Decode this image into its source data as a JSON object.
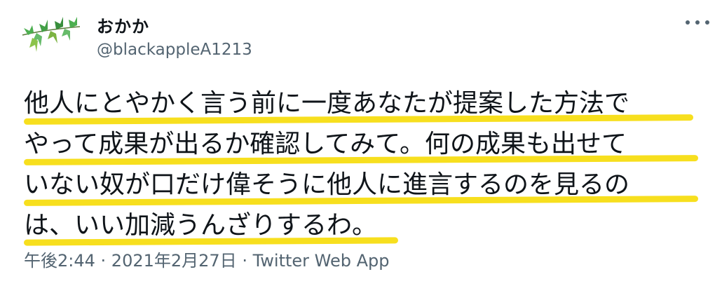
{
  "tweet": {
    "display_name": "おかか",
    "handle": "@blackappleA1213",
    "lines": [
      "他人にとやかく言う前に一度あなたが提案した方法で",
      "やって成果が出るか確認してみて。何の成果も出せて",
      "いない奴が口だけ偉そうに他人に進言するのを見るの",
      "は、いい加減うんざりするわ。"
    ],
    "time": "午後2:44",
    "separator": " · ",
    "date": "2021年2月27日",
    "app": "Twitter Web App"
  },
  "icons": {
    "avatar": "ivy-leaves-avatar",
    "more": "more-dots-icon"
  },
  "colors": {
    "text": "#0f1419",
    "secondary": "#536471",
    "highlight_underline": "#f7df1e",
    "leaf_green": "#4caf50"
  }
}
